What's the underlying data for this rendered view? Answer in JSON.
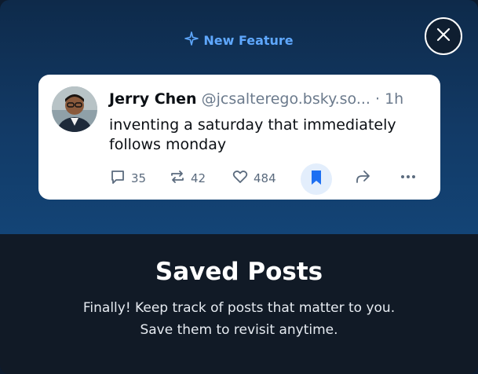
{
  "modal": {
    "feature_tag": "New Feature",
    "title": "Saved Posts",
    "description_line1": "Finally! Keep track of posts that matter to you.",
    "description_line2": "Save them to revisit anytime."
  },
  "post": {
    "author": "Jerry Chen",
    "handle": "@jcsalterego.bsky.so...",
    "time": "· 1h",
    "text_line1": "inventing a saturday that immediately",
    "text_line2": "follows monday",
    "replies": "35",
    "reposts": "42",
    "likes": "484"
  },
  "icons": {
    "close": "close-icon",
    "sparkle": "sparkle-icon",
    "reply": "reply-icon",
    "repost": "repost-icon",
    "like": "heart-icon",
    "bookmark": "bookmark-icon",
    "share": "share-icon",
    "more": "more-icon"
  },
  "colors": {
    "accent": "#1d6ff2",
    "feature_tag": "#5fa8ff",
    "hero_top": "#0e2a4a",
    "body_bg": "#111a26"
  }
}
